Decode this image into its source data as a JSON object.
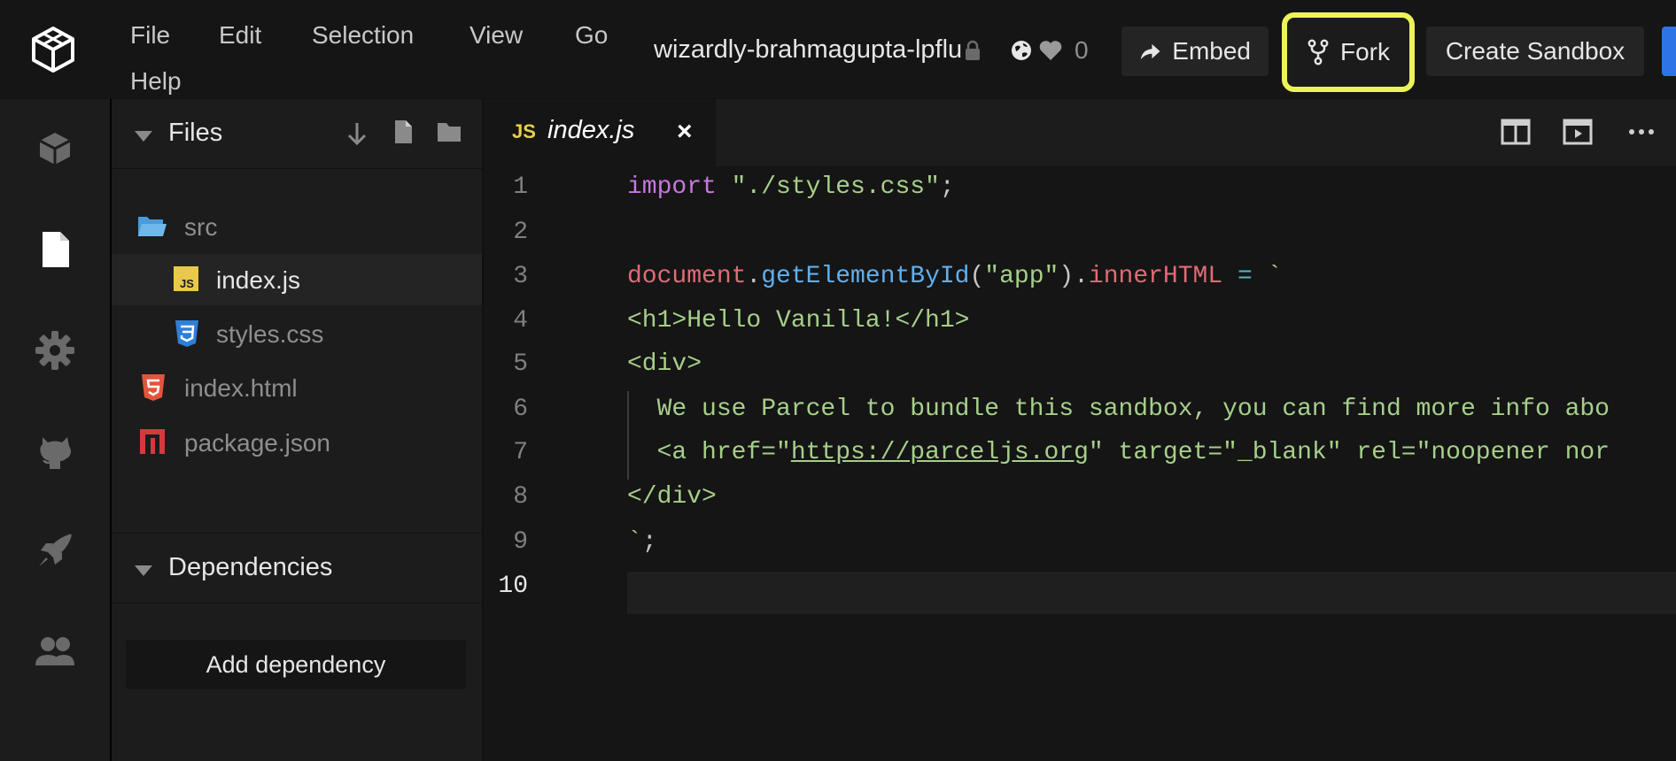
{
  "menu": [
    "File",
    "Edit",
    "Selection",
    "View",
    "Go",
    "Help"
  ],
  "header": {
    "sandbox_name": "wizardly-brahmagupta-lpflu",
    "like_count": "0",
    "embed_label": "Embed",
    "fork_label": "Fork",
    "create_label": "Create Sandbox"
  },
  "sidebar": {
    "files_title": "Files",
    "files": [
      {
        "name": "src",
        "icon": "folder-icon"
      },
      {
        "name": "index.js",
        "icon": "js-file-icon"
      },
      {
        "name": "styles.css",
        "icon": "css-file-icon"
      },
      {
        "name": "index.html",
        "icon": "html-file-icon"
      },
      {
        "name": "package.json",
        "icon": "npm-package-icon"
      }
    ],
    "dependencies_title": "Dependencies",
    "add_dependency_label": "Add dependency"
  },
  "editor": {
    "tab_badge": "JS",
    "tab_name": "index.js",
    "tab_close": "×",
    "line_numbers": [
      "1",
      "2",
      "3",
      "4",
      "5",
      "6",
      "7",
      "8",
      "9",
      "10"
    ],
    "code": {
      "l1_kw": "import",
      "l1_str": " \"./styles.css\"",
      "l1_end": ";",
      "l3_obj": "document",
      "l3_dot": ".",
      "l3_fn": "getElementById",
      "l3_p1": "(",
      "l3_arg": "\"app\"",
      "l3_p2": ").",
      "l3_prop": "innerHTML",
      "l3_eq": " = ",
      "l3_tick": "`",
      "l4": "<h1>Hello Vanilla!</h1>",
      "l5": "<div>",
      "l6": "  We use Parcel to bundle this sandbox, you can find more info abo",
      "l7_a": "  <a href=\"",
      "l7_url": "https://parceljs.org",
      "l7_b": "\" target=\"_blank\" rel=\"noopener nor",
      "l8": "</div>",
      "l9_tick": "`",
      "l9_end": ";"
    }
  },
  "colors": {
    "fork_highlight": "#eef25a",
    "accent_blue": "#2f74e6"
  }
}
